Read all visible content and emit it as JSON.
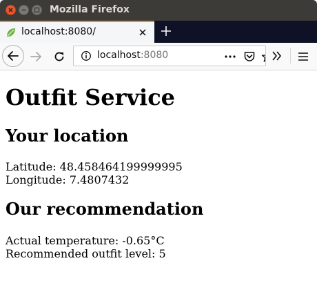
{
  "window": {
    "title": "Mozilla Firefox"
  },
  "tab": {
    "title": "localhost:8080/"
  },
  "urlbar": {
    "host": "localhost",
    "port": ":8080"
  },
  "page": {
    "title": "Outfit Service",
    "location_heading": "Your location",
    "latitude_text": "Latitude: 48.458464199999995",
    "longitude_text": "Longitude: 7.4807432",
    "recommendation_heading": "Our recommendation",
    "temperature_text": "Actual temperature: -0.65°C",
    "outfit_text": "Recommended outfit level: 5"
  },
  "icons": {
    "favicon": "spring-leaf-icon",
    "colors": {
      "accent": "#f08b28",
      "close_button": "#e9582f",
      "favicon": "#6db33f"
    }
  }
}
